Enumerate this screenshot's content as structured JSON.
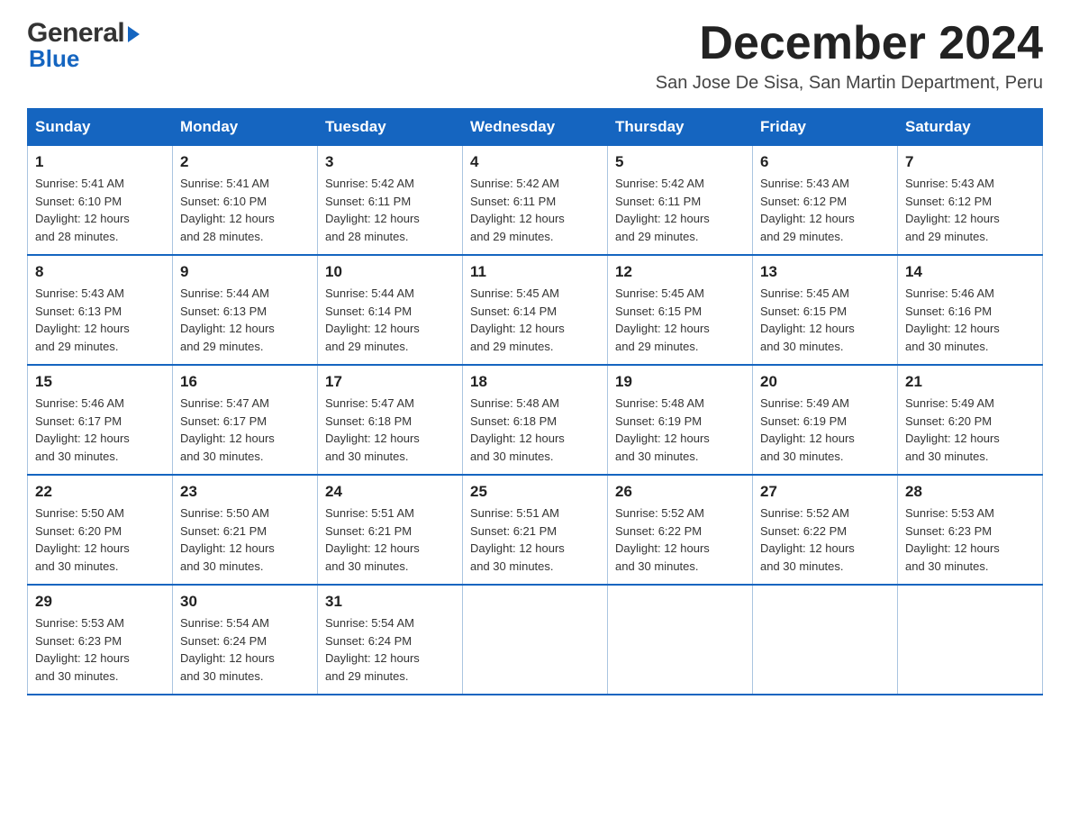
{
  "logo": {
    "general": "General",
    "blue": "Blue",
    "arrow": "▶"
  },
  "title": "December 2024",
  "subtitle": "San Jose De Sisa, San Martin Department, Peru",
  "days_header": [
    "Sunday",
    "Monday",
    "Tuesday",
    "Wednesday",
    "Thursday",
    "Friday",
    "Saturday"
  ],
  "weeks": [
    [
      {
        "day": "1",
        "sunrise": "5:41 AM",
        "sunset": "6:10 PM",
        "daylight": "12 hours and 28 minutes."
      },
      {
        "day": "2",
        "sunrise": "5:41 AM",
        "sunset": "6:10 PM",
        "daylight": "12 hours and 28 minutes."
      },
      {
        "day": "3",
        "sunrise": "5:42 AM",
        "sunset": "6:11 PM",
        "daylight": "12 hours and 28 minutes."
      },
      {
        "day": "4",
        "sunrise": "5:42 AM",
        "sunset": "6:11 PM",
        "daylight": "12 hours and 29 minutes."
      },
      {
        "day": "5",
        "sunrise": "5:42 AM",
        "sunset": "6:11 PM",
        "daylight": "12 hours and 29 minutes."
      },
      {
        "day": "6",
        "sunrise": "5:43 AM",
        "sunset": "6:12 PM",
        "daylight": "12 hours and 29 minutes."
      },
      {
        "day": "7",
        "sunrise": "5:43 AM",
        "sunset": "6:12 PM",
        "daylight": "12 hours and 29 minutes."
      }
    ],
    [
      {
        "day": "8",
        "sunrise": "5:43 AM",
        "sunset": "6:13 PM",
        "daylight": "12 hours and 29 minutes."
      },
      {
        "day": "9",
        "sunrise": "5:44 AM",
        "sunset": "6:13 PM",
        "daylight": "12 hours and 29 minutes."
      },
      {
        "day": "10",
        "sunrise": "5:44 AM",
        "sunset": "6:14 PM",
        "daylight": "12 hours and 29 minutes."
      },
      {
        "day": "11",
        "sunrise": "5:45 AM",
        "sunset": "6:14 PM",
        "daylight": "12 hours and 29 minutes."
      },
      {
        "day": "12",
        "sunrise": "5:45 AM",
        "sunset": "6:15 PM",
        "daylight": "12 hours and 29 minutes."
      },
      {
        "day": "13",
        "sunrise": "5:45 AM",
        "sunset": "6:15 PM",
        "daylight": "12 hours and 30 minutes."
      },
      {
        "day": "14",
        "sunrise": "5:46 AM",
        "sunset": "6:16 PM",
        "daylight": "12 hours and 30 minutes."
      }
    ],
    [
      {
        "day": "15",
        "sunrise": "5:46 AM",
        "sunset": "6:17 PM",
        "daylight": "12 hours and 30 minutes."
      },
      {
        "day": "16",
        "sunrise": "5:47 AM",
        "sunset": "6:17 PM",
        "daylight": "12 hours and 30 minutes."
      },
      {
        "day": "17",
        "sunrise": "5:47 AM",
        "sunset": "6:18 PM",
        "daylight": "12 hours and 30 minutes."
      },
      {
        "day": "18",
        "sunrise": "5:48 AM",
        "sunset": "6:18 PM",
        "daylight": "12 hours and 30 minutes."
      },
      {
        "day": "19",
        "sunrise": "5:48 AM",
        "sunset": "6:19 PM",
        "daylight": "12 hours and 30 minutes."
      },
      {
        "day": "20",
        "sunrise": "5:49 AM",
        "sunset": "6:19 PM",
        "daylight": "12 hours and 30 minutes."
      },
      {
        "day": "21",
        "sunrise": "5:49 AM",
        "sunset": "6:20 PM",
        "daylight": "12 hours and 30 minutes."
      }
    ],
    [
      {
        "day": "22",
        "sunrise": "5:50 AM",
        "sunset": "6:20 PM",
        "daylight": "12 hours and 30 minutes."
      },
      {
        "day": "23",
        "sunrise": "5:50 AM",
        "sunset": "6:21 PM",
        "daylight": "12 hours and 30 minutes."
      },
      {
        "day": "24",
        "sunrise": "5:51 AM",
        "sunset": "6:21 PM",
        "daylight": "12 hours and 30 minutes."
      },
      {
        "day": "25",
        "sunrise": "5:51 AM",
        "sunset": "6:21 PM",
        "daylight": "12 hours and 30 minutes."
      },
      {
        "day": "26",
        "sunrise": "5:52 AM",
        "sunset": "6:22 PM",
        "daylight": "12 hours and 30 minutes."
      },
      {
        "day": "27",
        "sunrise": "5:52 AM",
        "sunset": "6:22 PM",
        "daylight": "12 hours and 30 minutes."
      },
      {
        "day": "28",
        "sunrise": "5:53 AM",
        "sunset": "6:23 PM",
        "daylight": "12 hours and 30 minutes."
      }
    ],
    [
      {
        "day": "29",
        "sunrise": "5:53 AM",
        "sunset": "6:23 PM",
        "daylight": "12 hours and 30 minutes."
      },
      {
        "day": "30",
        "sunrise": "5:54 AM",
        "sunset": "6:24 PM",
        "daylight": "12 hours and 30 minutes."
      },
      {
        "day": "31",
        "sunrise": "5:54 AM",
        "sunset": "6:24 PM",
        "daylight": "12 hours and 29 minutes."
      },
      null,
      null,
      null,
      null
    ]
  ],
  "labels": {
    "sunrise": "Sunrise:",
    "sunset": "Sunset:",
    "daylight": "Daylight:"
  }
}
